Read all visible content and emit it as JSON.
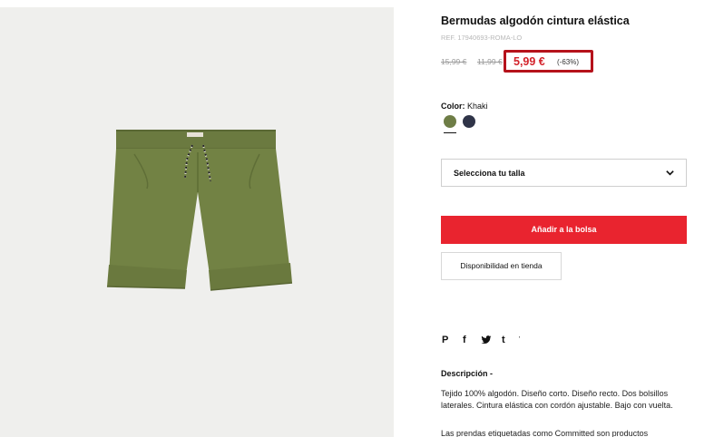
{
  "product": {
    "title": "Bermudas algodón cintura elástica",
    "ref": "REF. 17940693-ROMA-LO",
    "image_alt": "khaki shorts"
  },
  "price": {
    "original": "15,99 €",
    "previous": "11,99 €",
    "sale": "5,99 €",
    "discount": "(-63%)",
    "sale_color": "#d3222a",
    "highlight_color": "#b5121b"
  },
  "color": {
    "label": "Color:",
    "selected": "Khaki",
    "swatches": [
      {
        "name": "Khaki",
        "hex": "#6e7d46"
      },
      {
        "name": "Navy",
        "hex": "#2f3448"
      }
    ]
  },
  "size": {
    "placeholder": "Selecciona tu talla",
    "icon": "chevron-down-icon"
  },
  "actions": {
    "add_to_bag": "Añadir a la bolsa",
    "add_to_bag_color": "#e9242f",
    "store_availability": "Disponibilidad en tienda"
  },
  "share": {
    "icons": [
      "pinterest-icon",
      "facebook-icon",
      "twitter-icon",
      "tumblr-icon",
      "more-icon"
    ],
    "pinterest": "P",
    "facebook": "f",
    "twitter": "t",
    "tumblr": "t",
    "more": "'"
  },
  "description": {
    "title": "Descripción -",
    "text": "Tejido 100% algodón. Diseño corto. Diseño recto. Dos bolsillos laterales. Cintura elástica con cordón ajustable. Bajo con vuelta.",
    "text_more": "Las prendas etiquetadas como Committed son productos"
  }
}
